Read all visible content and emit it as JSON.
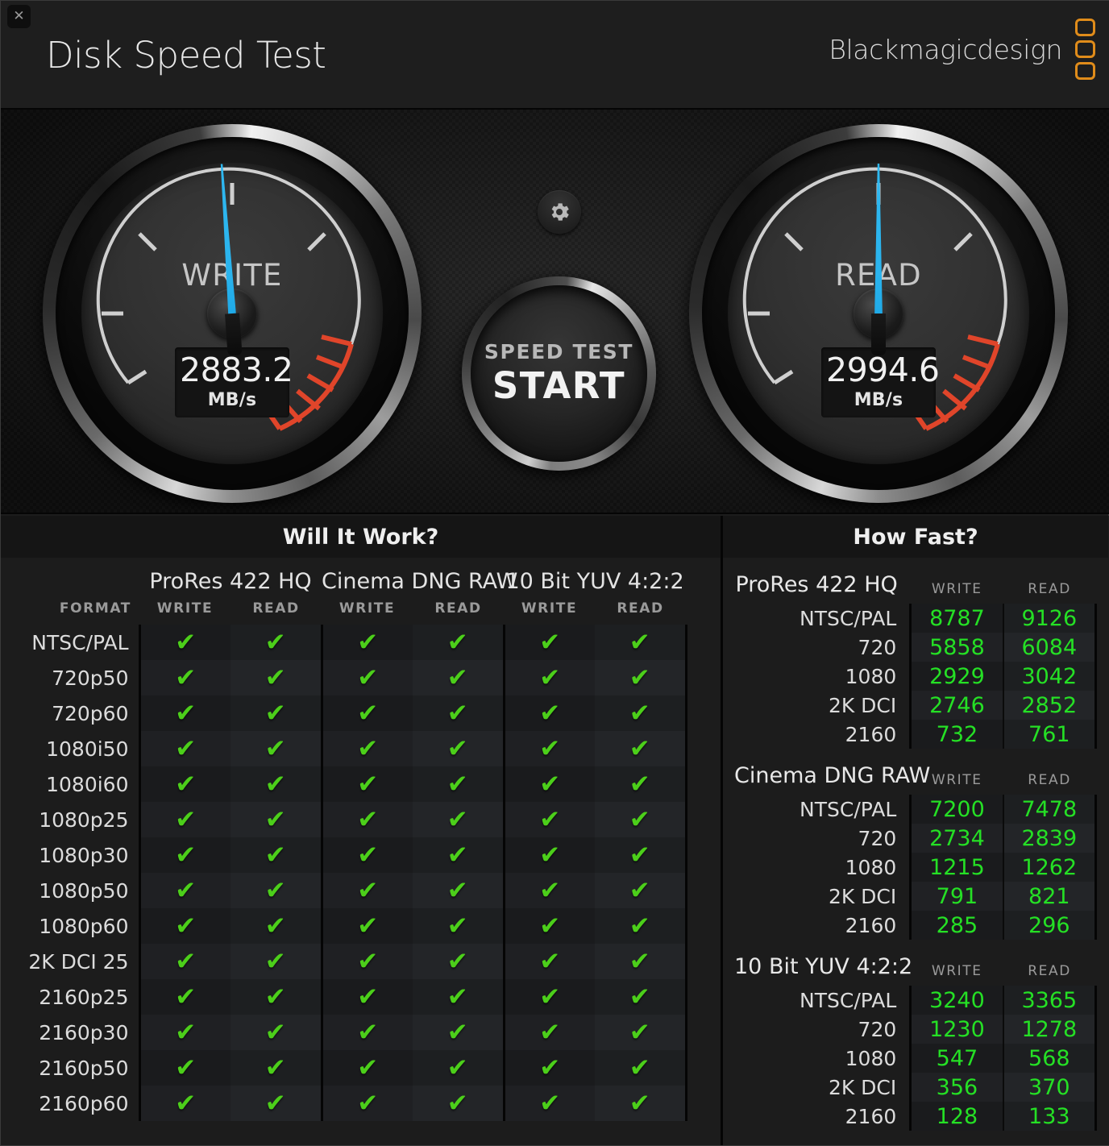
{
  "window": {
    "close_label": "✕",
    "title": "Disk Speed Test",
    "brand": "Blackmagicdesign"
  },
  "gauges": {
    "write": {
      "label": "WRITE",
      "value": "2883.2",
      "unit": "MB/s",
      "needle_deg": -4
    },
    "read": {
      "label": "READ",
      "value": "2994.6",
      "unit": "MB/s",
      "needle_deg": 0
    },
    "gear_icon": "gear-icon",
    "start_button": {
      "top_label": "SPEED TEST",
      "main_label": "START"
    }
  },
  "colors": {
    "needle": "#2ab4ee",
    "redzone": "#e0452a",
    "check": "#4ccf1a",
    "number": "#25e025",
    "brand_orange": "#e08c1a"
  },
  "will_it_work": {
    "title": "Will It Work?",
    "format_header": "FORMAT",
    "groups": [
      "ProRes 422 HQ",
      "Cinema DNG RAW",
      "10 Bit YUV 4:2:2"
    ],
    "sub_headers": [
      "WRITE",
      "READ"
    ],
    "check_glyph": "✔",
    "rows": [
      {
        "format": "NTSC/PAL",
        "checks": [
          true,
          true,
          true,
          true,
          true,
          true
        ]
      },
      {
        "format": "720p50",
        "checks": [
          true,
          true,
          true,
          true,
          true,
          true
        ]
      },
      {
        "format": "720p60",
        "checks": [
          true,
          true,
          true,
          true,
          true,
          true
        ]
      },
      {
        "format": "1080i50",
        "checks": [
          true,
          true,
          true,
          true,
          true,
          true
        ]
      },
      {
        "format": "1080i60",
        "checks": [
          true,
          true,
          true,
          true,
          true,
          true
        ]
      },
      {
        "format": "1080p25",
        "checks": [
          true,
          true,
          true,
          true,
          true,
          true
        ]
      },
      {
        "format": "1080p30",
        "checks": [
          true,
          true,
          true,
          true,
          true,
          true
        ]
      },
      {
        "format": "1080p50",
        "checks": [
          true,
          true,
          true,
          true,
          true,
          true
        ]
      },
      {
        "format": "1080p60",
        "checks": [
          true,
          true,
          true,
          true,
          true,
          true
        ]
      },
      {
        "format": "2K DCI 25",
        "checks": [
          true,
          true,
          true,
          true,
          true,
          true
        ]
      },
      {
        "format": "2160p25",
        "checks": [
          true,
          true,
          true,
          true,
          true,
          true
        ]
      },
      {
        "format": "2160p30",
        "checks": [
          true,
          true,
          true,
          true,
          true,
          true
        ]
      },
      {
        "format": "2160p50",
        "checks": [
          true,
          true,
          true,
          true,
          true,
          true
        ]
      },
      {
        "format": "2160p60",
        "checks": [
          true,
          true,
          true,
          true,
          true,
          true
        ]
      }
    ]
  },
  "how_fast": {
    "title": "How Fast?",
    "sub_headers": [
      "WRITE",
      "READ"
    ],
    "sections": [
      {
        "name": "ProRes 422 HQ",
        "rows": [
          {
            "label": "NTSC/PAL",
            "write": "8787",
            "read": "9126"
          },
          {
            "label": "720",
            "write": "5858",
            "read": "6084"
          },
          {
            "label": "1080",
            "write": "2929",
            "read": "3042"
          },
          {
            "label": "2K DCI",
            "write": "2746",
            "read": "2852"
          },
          {
            "label": "2160",
            "write": "732",
            "read": "761"
          }
        ]
      },
      {
        "name": "Cinema DNG RAW",
        "rows": [
          {
            "label": "NTSC/PAL",
            "write": "7200",
            "read": "7478"
          },
          {
            "label": "720",
            "write": "2734",
            "read": "2839"
          },
          {
            "label": "1080",
            "write": "1215",
            "read": "1262"
          },
          {
            "label": "2K DCI",
            "write": "791",
            "read": "821"
          },
          {
            "label": "2160",
            "write": "285",
            "read": "296"
          }
        ]
      },
      {
        "name": "10 Bit YUV 4:2:2",
        "rows": [
          {
            "label": "NTSC/PAL",
            "write": "3240",
            "read": "3365"
          },
          {
            "label": "720",
            "write": "1230",
            "read": "1278"
          },
          {
            "label": "1080",
            "write": "547",
            "read": "568"
          },
          {
            "label": "2K DCI",
            "write": "356",
            "read": "370"
          },
          {
            "label": "2160",
            "write": "128",
            "read": "133"
          }
        ]
      }
    ]
  }
}
